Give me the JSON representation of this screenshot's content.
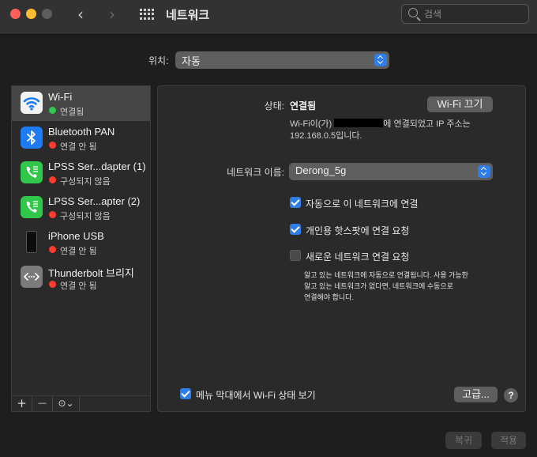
{
  "window": {
    "title": "네트워크"
  },
  "search": {
    "placeholder": "검색"
  },
  "location": {
    "label": "위치:",
    "value": "자동"
  },
  "services": [
    {
      "name": "Wi-Fi",
      "status": "연결됨",
      "status_color": "#30c94d",
      "icon": "wifi-icon",
      "selected": true
    },
    {
      "name": "Bluetooth PAN",
      "status": "연결 안 됨",
      "status_color": "#ff3b30",
      "icon": "bluetooth-icon"
    },
    {
      "name": "LPSS Ser...dapter (1)",
      "status": "구성되지 않음",
      "status_color": "#ff3b30",
      "icon": "phone-icon"
    },
    {
      "name": "LPSS Ser...apter (2)",
      "status": "구성되지 않음",
      "status_color": "#ff3b30",
      "icon": "phone-icon"
    },
    {
      "name": "iPhone USB",
      "status": "연결 안 됨",
      "status_color": "#ff3b30",
      "icon": "iphone-icon"
    },
    {
      "name": "Thunderbolt 브리지",
      "status": "연결 안 됨",
      "status_color": "#ff3b30",
      "icon": "thunderbolt-bridge-icon"
    }
  ],
  "sidebar_toolbar": {
    "add": "+",
    "remove": "—",
    "action": "⊙⌄"
  },
  "detail": {
    "status_label": "상태:",
    "status_value": "연결됨",
    "wifi_off_button": "Wi-Fi 끄기",
    "desc_prefix": "Wi-Fi이(가) ",
    "desc_suffix": "에 연결되었고 IP 주소는",
    "desc_line2": "192.168.0.5입니다.",
    "network_name_label": "네트워크 이름:",
    "network_name_value": "Derong_5g",
    "auto_join_label": "자동으로 이 네트워크에 연결",
    "auto_join_checked": true,
    "hotspot_label": "개인용 핫스팟에 연결 요청",
    "hotspot_checked": true,
    "ask_new_label": "새로운 네트워크 연결 요청",
    "ask_new_checked": false,
    "help_line1": "알고 있는 네트워크에 자동으로 연결됩니다. 사용 가능한",
    "help_line2": "알고 있는 네트워크가 없다면, 네트워크에 수동으로",
    "help_line3": "연결해야 합니다.",
    "menubar_label": "메뉴 막대에서 Wi-Fi 상태 보기",
    "menubar_checked": true,
    "advanced_button": "고급...",
    "help_button": "?"
  },
  "footer": {
    "revert": "복귀",
    "apply": "적용"
  }
}
